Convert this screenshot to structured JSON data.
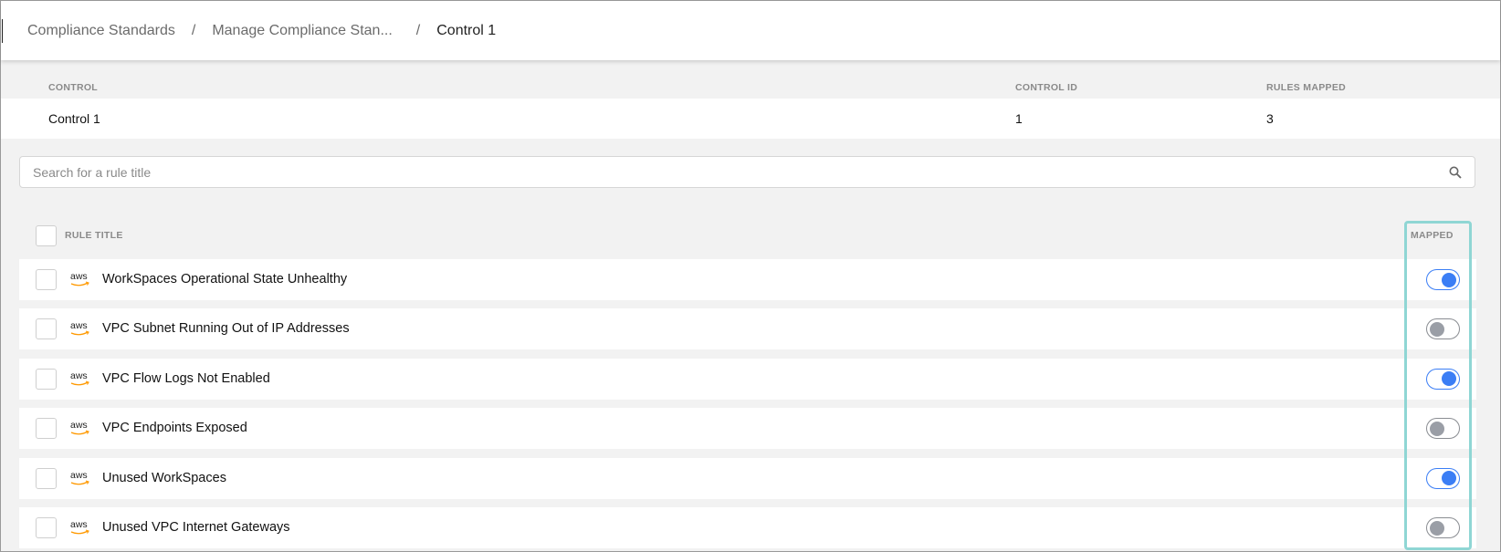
{
  "breadcrumb": [
    "Compliance Standards",
    "Manage Compliance Stan...",
    "Control 1"
  ],
  "summary": {
    "headers": {
      "control": "CONTROL",
      "control_id": "CONTROL ID",
      "rules_mapped": "RULES MAPPED"
    },
    "values": {
      "control": "Control 1",
      "control_id": "1",
      "rules_mapped": "3"
    }
  },
  "search": {
    "placeholder": "Search for a rule title",
    "value": ""
  },
  "table": {
    "headers": {
      "rule_title": "RULE TITLE",
      "mapped": "MAPPED"
    },
    "rows": [
      {
        "provider": "aws",
        "title": "WorkSpaces Operational State Unhealthy",
        "mapped": true
      },
      {
        "provider": "aws",
        "title": "VPC Subnet Running Out of IP Addresses",
        "mapped": false
      },
      {
        "provider": "aws",
        "title": "VPC Flow Logs Not Enabled",
        "mapped": true
      },
      {
        "provider": "aws",
        "title": "VPC Endpoints Exposed",
        "mapped": false
      },
      {
        "provider": "aws",
        "title": "Unused WorkSpaces",
        "mapped": true
      },
      {
        "provider": "aws",
        "title": "Unused VPC Internet Gateways",
        "mapped": false
      }
    ]
  },
  "colors": {
    "toggle_on": "#3b7ef5",
    "toggle_off": "#9a9ea6",
    "highlight": "#8fd6d4"
  }
}
